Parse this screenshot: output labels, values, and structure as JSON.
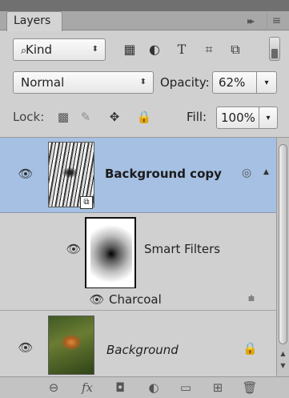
{
  "panel": {
    "tab_label": "Layers",
    "collapse_glyph": "▸▸",
    "menu_glyph": "≡"
  },
  "filter": {
    "kind_label": "Kind",
    "search_glyph": "⌕",
    "spin_glyph": "⬍",
    "icons": [
      "pixel-filter-icon",
      "adjustment-filter-icon",
      "type-filter-icon",
      "shape-filter-icon",
      "smartobject-filter-icon"
    ],
    "icon_glyphs": [
      "▦",
      "◐",
      "T",
      "⌗",
      "⧉"
    ]
  },
  "blend": {
    "mode": "Normal",
    "opacity_label": "Opacity:",
    "opacity_value": "62%",
    "arrow": "▾"
  },
  "lock": {
    "label": "Lock:",
    "glyphs": [
      "▩",
      "✎",
      "✥",
      "🔒"
    ],
    "fill_label": "Fill:",
    "fill_value": "100%"
  },
  "layers": [
    {
      "name": "Background copy",
      "visible": true,
      "selected": true,
      "type": "smart-object"
    },
    {
      "name": "Smart Filters",
      "visible": true,
      "type": "smart-filter-mask"
    },
    {
      "name": "Charcoal",
      "visible": true,
      "type": "filter-effect"
    },
    {
      "name": "Background",
      "visible": true,
      "locked": true,
      "type": "background"
    }
  ],
  "glyphs": {
    "eye": "👁",
    "smart_indicator": "◎",
    "expand": "▲",
    "filter_options": "⩧",
    "lock": "🔒",
    "smartobj_badge": "⧉",
    "scroll_up": "▲",
    "scroll_down": "▼"
  },
  "bottom_icons": [
    "link-layers-icon",
    "fx-icon",
    "add-mask-icon",
    "adjustment-layer-icon",
    "group-folder-icon",
    "new-layer-icon",
    "trash-icon"
  ],
  "bottom_glyphs": [
    "⊖",
    "fx",
    "◘",
    "◐",
    "▭",
    "⊞",
    "🗑"
  ],
  "colors": {
    "selected_row": "#a5c0e2",
    "panel_bg": "#d0d0d0"
  }
}
